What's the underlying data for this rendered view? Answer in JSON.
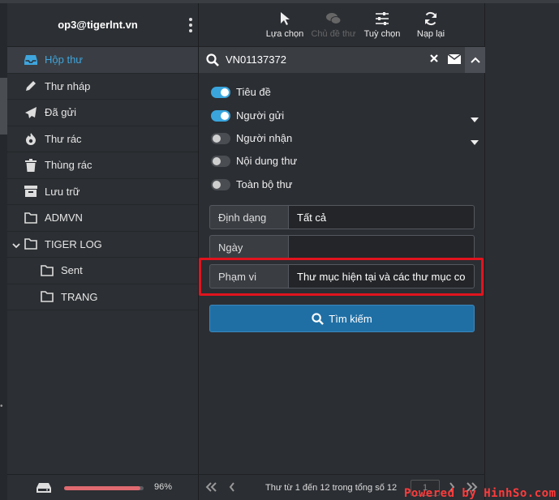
{
  "account": {
    "email": "op3@tigerlnt.vn"
  },
  "sidebar": {
    "folders": [
      {
        "label": "Hộp thư",
        "icon": "inbox-icon"
      },
      {
        "label": "Thư nháp",
        "icon": "pencil-icon"
      },
      {
        "label": "Đã gửi",
        "icon": "paper-plane-icon"
      },
      {
        "label": "Thư rác",
        "icon": "fire-icon"
      },
      {
        "label": "Thùng rác",
        "icon": "trash-icon"
      },
      {
        "label": "Lưu trữ",
        "icon": "archive-icon"
      },
      {
        "label": "ADMVN",
        "icon": "folder-icon"
      },
      {
        "label": "TIGER LOG",
        "icon": "folder-icon"
      },
      {
        "label": "Sent",
        "icon": "folder-icon"
      },
      {
        "label": "TRANG",
        "icon": "folder-icon"
      }
    ],
    "quota": {
      "percent_label": "96%",
      "fraction": 0.96
    }
  },
  "toolbar": {
    "select_label": "Lựa chọn",
    "thread_label": "Chủ đề thư",
    "options_label": "Tuỳ chọn",
    "refresh_label": "Nạp lại"
  },
  "search": {
    "query": "VN01137372",
    "options": [
      {
        "label": "Tiêu đề",
        "on": true
      },
      {
        "label": "Người gửi",
        "on": true
      },
      {
        "label": "Người nhận",
        "on": false
      },
      {
        "label": "Nội dung thư",
        "on": false
      },
      {
        "label": "Toàn bộ thư",
        "on": false
      }
    ],
    "type_label": "Định dạng",
    "type_value": "Tất cả",
    "date_label": "Ngày",
    "date_value": "",
    "scope_label": "Phạm vi",
    "scope_value": "Thư mục hiện tại và các thư mục co",
    "button_label": "Tìm kiếm"
  },
  "pager": {
    "status": "Thư từ 1 đến 12 trong tổng số 12",
    "page": "1"
  },
  "colors": {
    "accent": "#3aa5dd",
    "button": "#1f6fa5",
    "highlight": "#e0141e"
  },
  "watermark": "Powered by HinhSo.com"
}
